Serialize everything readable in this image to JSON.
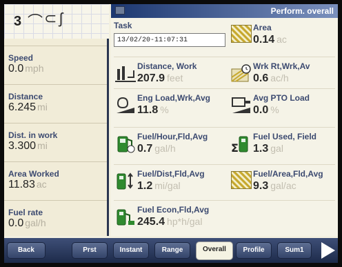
{
  "header": {
    "top_number": "3",
    "title": "Perform. overall"
  },
  "left_panel": [
    {
      "label": "Speed",
      "value": "0.0",
      "unit": "mph"
    },
    {
      "label": "Distance",
      "value": "6.245",
      "unit": "mi"
    },
    {
      "label": "Dist. in work",
      "value": "3.300",
      "unit": "mi"
    },
    {
      "label": "Area Worked",
      "value": "11.83",
      "unit": "ac"
    },
    {
      "label": "Fuel rate",
      "value": "0.0",
      "unit": "gal/h"
    }
  ],
  "task": {
    "label": "Task",
    "value": "13/02/20-11:07:31"
  },
  "metrics": {
    "area": {
      "label": "Area",
      "value": "0.14",
      "unit": "ac",
      "icon": "hatched-area-icon"
    },
    "distance_work": {
      "label": "Distance, Work",
      "value": "207.9",
      "unit": "feet",
      "icon": "distance-gauge-icon"
    },
    "work_rate": {
      "label": "Wrk Rt,Wrk,Av",
      "value": "0.6",
      "unit": "ac/h",
      "icon": "work-rate-icon"
    },
    "engine_load": {
      "label": "Eng Load,Wrk,Avg",
      "value": "11.8",
      "unit": "%",
      "icon": "engine-load-icon"
    },
    "pto_load": {
      "label": "Avg PTO Load",
      "value": "0.0",
      "unit": "%",
      "icon": "pto-icon"
    },
    "fuel_hour": {
      "label": "Fuel/Hour,Fld,Avg",
      "value": "0.7",
      "unit": "gal/h",
      "icon": "fuel-pump-clock-icon"
    },
    "fuel_used": {
      "label": "Fuel Used, Field",
      "value": "1.3",
      "unit": "gal",
      "icon": "fuel-sum-icon"
    },
    "fuel_dist": {
      "label": "Fuel/Dist,Fld,Avg",
      "value": "1.2",
      "unit": "mi/gal",
      "icon": "fuel-distance-icon"
    },
    "fuel_area": {
      "label": "Fuel/Area,Fld,Avg",
      "value": "9.3",
      "unit": "gal/ac",
      "icon": "fuel-area-icon"
    },
    "fuel_econ": {
      "label": "Fuel Econ,Fld,Avg",
      "value": "245.4",
      "unit": "hp*h/gal",
      "icon": "fuel-econ-icon"
    }
  },
  "bottom_bar": {
    "buttons": [
      "Back",
      "Prst",
      "Instant",
      "Range",
      "Overall",
      "Profile",
      "Sum1"
    ],
    "active": "Overall"
  },
  "colors": {
    "label_blue": "#3c4a70",
    "title_bar": "#1c3770",
    "hatch_yellow": "#c7a930",
    "fuel_green": "#2f8a2f"
  }
}
